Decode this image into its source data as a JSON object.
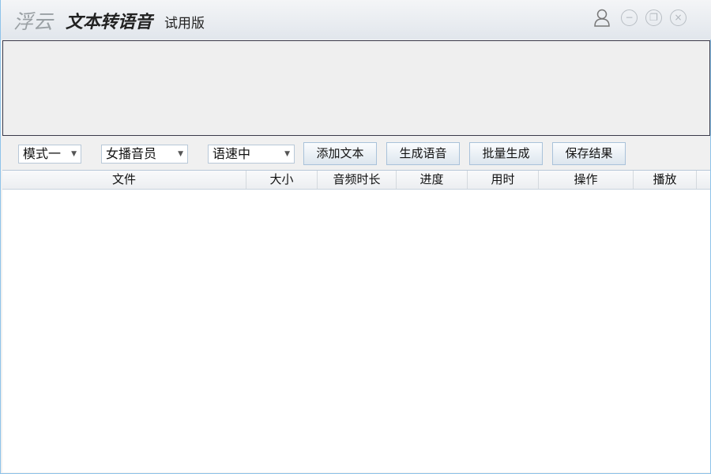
{
  "titlebar": {
    "logo": "浮云",
    "title": "文本转语音",
    "edition": "试用版",
    "icons": [
      "user-icon",
      "minimize-icon",
      "restore-icon",
      "close-icon"
    ]
  },
  "toolbar": {
    "mode": "模式一",
    "voice": "女播音员",
    "speed": "语速中",
    "add_text": "添加文本",
    "generate": "生成语音",
    "batch": "批量生成",
    "save": "保存结果"
  },
  "table": {
    "columns": [
      "文件",
      "大小",
      "音频时长",
      "进度",
      "用时",
      "操作",
      "播放"
    ],
    "rows": []
  }
}
